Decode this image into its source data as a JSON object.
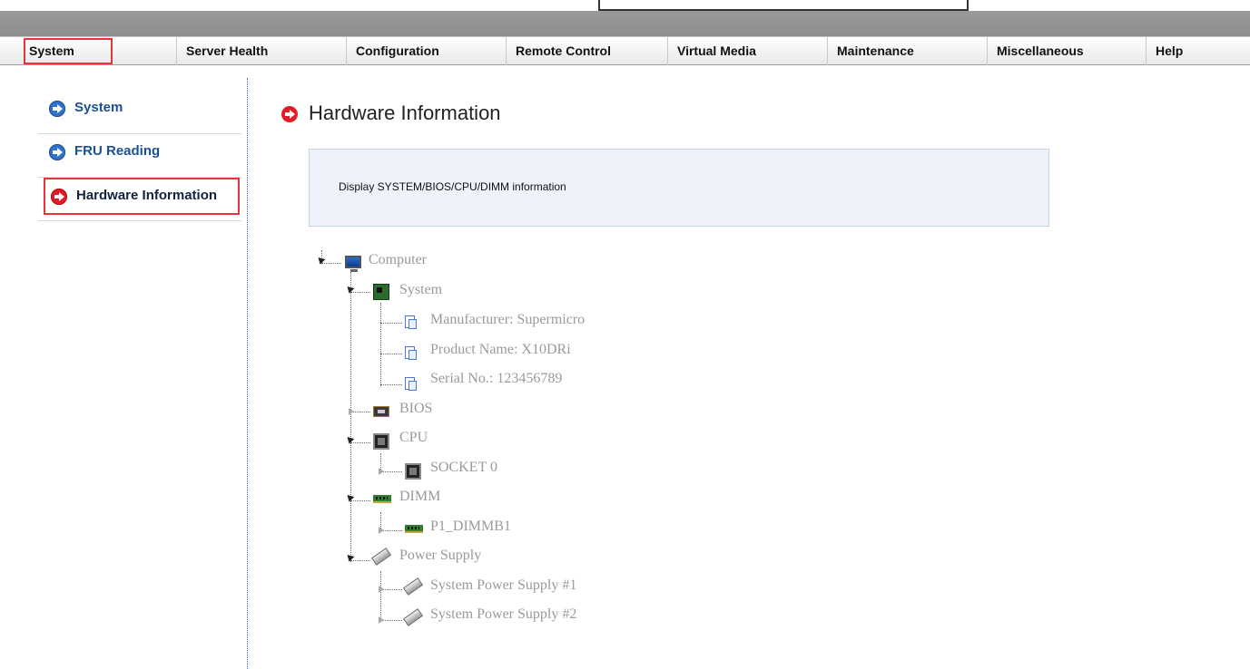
{
  "menu": {
    "items": [
      {
        "label": "System",
        "active": true
      },
      {
        "label": "Server Health"
      },
      {
        "label": "Configuration"
      },
      {
        "label": "Remote Control"
      },
      {
        "label": "Virtual Media"
      },
      {
        "label": "Maintenance"
      },
      {
        "label": "Miscellaneous"
      },
      {
        "label": "Help"
      }
    ]
  },
  "sidebar": {
    "items": [
      {
        "label": "System",
        "icon": "arrow-circle-blue-icon"
      },
      {
        "label": "FRU Reading",
        "icon": "arrow-circle-blue-icon"
      },
      {
        "label": "Hardware Information",
        "icon": "arrow-circle-red-icon",
        "active": true
      }
    ]
  },
  "main": {
    "title": "Hardware Information",
    "description": "Display SYSTEM/BIOS/CPU/DIMM information"
  },
  "tree": {
    "computer": "Computer",
    "system": "System",
    "manufacturer": "Manufacturer: Supermicro",
    "product_name": "Product Name: X10DRi",
    "serial_no": "Serial No.: 123456789",
    "bios": "BIOS",
    "cpu": "CPU",
    "socket0": "SOCKET 0",
    "dimm": "DIMM",
    "p1_dimmb1": "P1_DIMMB1",
    "power_supply": "Power Supply",
    "psu1": "System Power Supply #1",
    "psu2": "System Power Supply #2"
  },
  "colors": {
    "accent_red": "#e51b24",
    "accent_blue": "#2f72c9",
    "highlight_box": "#e8333b",
    "tree_text": "#9a9a9a"
  }
}
